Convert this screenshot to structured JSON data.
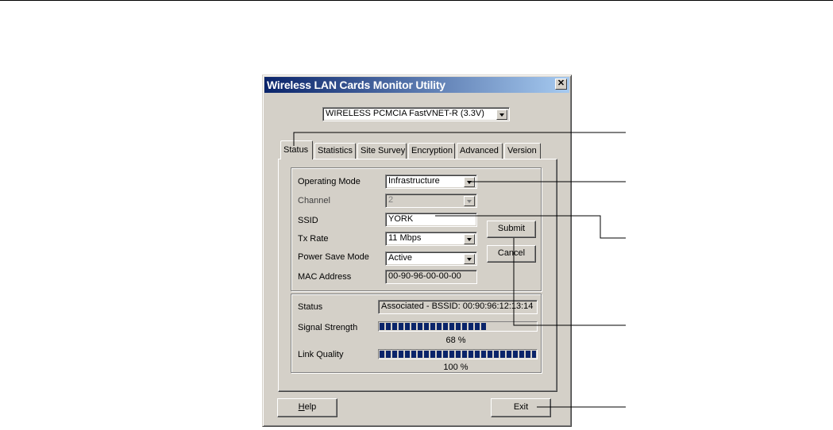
{
  "window": {
    "title": "Wireless LAN Cards Monitor Utility",
    "close_glyph": "✕"
  },
  "device_select": {
    "value": "WIRELESS PCMCIA FastVNET-R (3.3V)"
  },
  "tabs": [
    {
      "label": "Status",
      "active": true
    },
    {
      "label": "Statistics"
    },
    {
      "label": "Site Survey"
    },
    {
      "label": "Encryption"
    },
    {
      "label": "Advanced"
    },
    {
      "label": "Version"
    }
  ],
  "config": {
    "operating_mode": {
      "label": "Operating Mode",
      "value": "Infrastructure"
    },
    "channel": {
      "label": "Channel",
      "value": "2"
    },
    "ssid": {
      "label": "SSID",
      "value": "YORK"
    },
    "tx_rate": {
      "label": "Tx Rate",
      "value": "11 Mbps"
    },
    "power_save": {
      "label": "Power Save Mode",
      "value": "Active"
    },
    "mac": {
      "label": "MAC Address",
      "value": "00-90-96-00-00-00"
    },
    "submit_label": "Submit",
    "cancel_label": "Cancel"
  },
  "link": {
    "status_label": "Status",
    "status_value": "Associated - BSSID: 00:90:96:12:13:14",
    "signal_label": "Signal Strength",
    "signal_percent": 68,
    "signal_text": "68 %",
    "quality_label": "Link Quality",
    "quality_percent": 100,
    "quality_text": "100 %"
  },
  "footer": {
    "help_first": "H",
    "help_rest": "elp",
    "exit_label": "Exit"
  },
  "colors": {
    "title_start": "#0a246a",
    "title_end": "#a6caf0",
    "progress": "#0a246a",
    "face": "#d4d0c8"
  }
}
